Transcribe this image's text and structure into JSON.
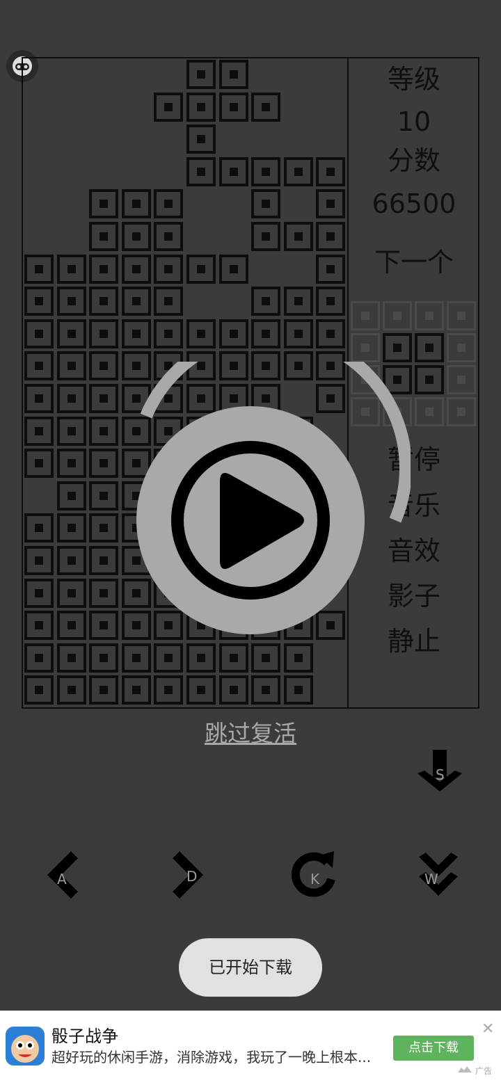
{
  "sidebar": {
    "level_label": "等级",
    "level_value": "10",
    "score_label": "分数",
    "score_value": "66500",
    "next_label": "下一个",
    "menu": [
      "暂停",
      "音乐",
      "音效",
      "影子",
      "静止"
    ]
  },
  "next_piece": {
    "grid_size": 4,
    "filled": [
      [
        1,
        1
      ],
      [
        1,
        2
      ],
      [
        2,
        1
      ],
      [
        2,
        2
      ]
    ]
  },
  "board": {
    "cols": 10,
    "rows": 20,
    "rows_data": [
      "00000XX000",
      "0000XXXX00",
      "00000X0000",
      "00000XXXXX",
      "00XXX00X0X",
      "00XXX00XXX",
      "XXXXXXX00X",
      "XXXXX00XXX",
      "XXXXXXXXXX",
      "XXXXXXXXXX",
      "XXXXXXXX0X",
      "XXXXXXXXX0",
      "XXXXXXXXX0",
      "0XXXXXXXX0",
      "XXXXXXXXX0",
      "XXXXXXXXX0",
      "XXXXXXXXX0",
      "XXXXXXXXXX",
      "XXXXXXXXX0",
      "XXXXXXXXX0"
    ]
  },
  "overlay": {
    "play_icon": "play-circle-icon",
    "skip_revive_label": "跳过复活"
  },
  "controls": {
    "drop_key": "S",
    "left_key": "A",
    "right_key": "D",
    "rotate_key": "K",
    "hard_drop_key": "W"
  },
  "toast": {
    "message": "已开始下载"
  },
  "ad": {
    "title": "骰子战争",
    "description": "超好玩的休闲手游，消除游戏，我玩了一晚上根本...",
    "cta_label": "点击下载",
    "ad_label": "广告"
  },
  "colors": {
    "background": "#3b3c3a",
    "block": "#0d0d0d",
    "overlay": "#a9a9a9",
    "cta": "#5fb35f"
  }
}
